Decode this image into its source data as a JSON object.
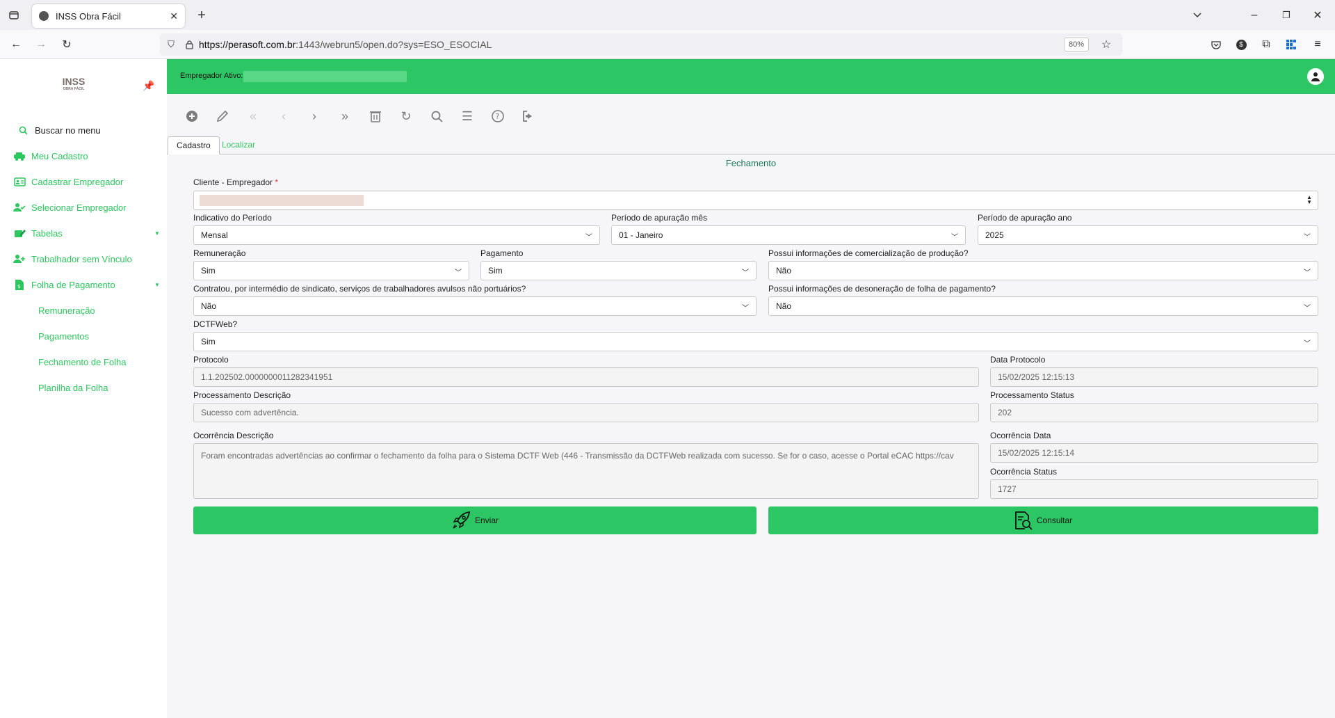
{
  "browser": {
    "tab_title": "INSS Obra Fácil",
    "url_host": "https://perasoft.com.br",
    "url_rest": ":1443/webrun5/open.do?sys=ESO_ESOCIAL",
    "zoom": "80%"
  },
  "sidebar": {
    "logo": "INSS",
    "logo_sub": "OBRA FÁCIL",
    "search": "Buscar no menu",
    "items": [
      {
        "label": "Meu Cadastro",
        "icon": "car-icon"
      },
      {
        "label": "Cadastrar Empregador",
        "icon": "id-card-icon"
      },
      {
        "label": "Selecionar Empregador",
        "icon": "user-check-icon"
      },
      {
        "label": "Tabelas",
        "icon": "edit-icon"
      },
      {
        "label": "Trabalhador sem Vínculo",
        "icon": "user-plus-icon"
      },
      {
        "label": "Folha de Pagamento",
        "icon": "file-icon"
      }
    ],
    "subitems": [
      "Remuneração",
      "Pagamentos",
      "Fechamento de Folha",
      "Planilha da Folha"
    ]
  },
  "header": {
    "employer_label": "Empregador Ativo:"
  },
  "tabs": {
    "active": "Cadastro",
    "inactive": "Localizar"
  },
  "form": {
    "title": "Fechamento",
    "cliente_label": "Cliente - Empregador",
    "required_mark": "*",
    "indicativo_label": "Indicativo do Período",
    "indicativo_value": "Mensal",
    "mes_label": "Período de apuração mês",
    "mes_value": "01 - Janeiro",
    "ano_label": "Período de apuração ano",
    "ano_value": "2025",
    "remuneracao_label": "Remuneração",
    "remuneracao_value": "Sim",
    "pagamento_label": "Pagamento",
    "pagamento_value": "Sim",
    "comercializacao_label": "Possui informações de comercialização de produção?",
    "comercializacao_value": "Não",
    "sindicato_label": "Contratou, por intermédio de sindicato, serviços de trabalhadores avulsos não portuários?",
    "sindicato_value": "Não",
    "desoneracao_label": "Possui informações de desoneração de folha de pagamento?",
    "desoneracao_value": "Não",
    "dctf_label": "DCTFWeb?",
    "dctf_value": "Sim",
    "protocolo_label": "Protocolo",
    "protocolo_value": "1.1.202502.0000000011282341951",
    "data_protocolo_label": "Data Protocolo",
    "data_protocolo_value": "15/02/2025 12:15:13",
    "proc_desc_label": "Processamento Descrição",
    "proc_desc_value": "Sucesso com advertência.",
    "proc_status_label": "Processamento Status",
    "proc_status_value": "202",
    "ocorr_desc_label": "Ocorrência Descrição",
    "ocorr_desc_value": "Foram encontradas advertências ao confirmar o fechamento da folha para o Sistema DCTF Web (446 - Transmissão da DCTFWeb realizada com sucesso. Se for o caso, acesse o Portal eCAC https://cav",
    "ocorr_data_label": "Ocorrência Data",
    "ocorr_data_value": "15/02/2025 12:15:14",
    "ocorr_status_label": "Ocorrência Status",
    "ocorr_status_value": "1727"
  },
  "buttons": {
    "enviar": "Enviar",
    "consultar": "Consultar"
  },
  "colors": {
    "accent": "#2dc665",
    "link": "#2ec65f"
  }
}
